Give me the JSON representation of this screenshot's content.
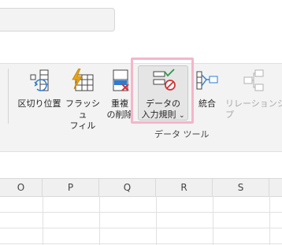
{
  "ribbon": {
    "buttons": [
      {
        "label": "区切り位置",
        "icon": "text-to-columns-icon"
      },
      {
        "label": "フラッシュ\nフィル",
        "icon": "flash-fill-icon"
      },
      {
        "label": "重複\nの削除",
        "icon": "remove-duplicates-icon"
      },
      {
        "label": "データの\n入力規則",
        "icon": "data-validation-icon",
        "chevron": "⌄"
      },
      {
        "label": "統合",
        "icon": "consolidate-icon"
      },
      {
        "label": "リレーションシップ",
        "icon": "relationships-icon"
      }
    ],
    "group_label": "データ ツール"
  },
  "sheet": {
    "columns": [
      "O",
      "P",
      "Q",
      "R",
      "S"
    ]
  },
  "colors": {
    "highlight": "#f4b6c9",
    "ribbon_bg": "#f3f3f3",
    "accent_blue": "#2b7cd3",
    "accent_orange": "#e8a317",
    "accent_red": "#d13438",
    "accent_green": "#2e9a4a"
  }
}
